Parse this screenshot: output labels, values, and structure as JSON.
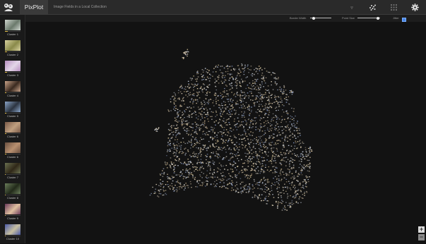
{
  "app": {
    "name": "PixPlot",
    "subtitle": "Image Fields in a Local Collection"
  },
  "toolbar": {
    "icons": [
      "dots-icon",
      "scatter-layout-icon",
      "grid-layout-icon",
      "settings-gear-icon"
    ],
    "border_width_label": "Border Width",
    "border_width_level": 0.15,
    "point_size_label": "Point Size",
    "point_size_level": 0.9,
    "jitter_label": "Jitter",
    "jitter_checked": true
  },
  "sidebar": {
    "clusters": [
      {
        "label": "Cluster 1",
        "progress": 0.2
      },
      {
        "label": "Cluster 2",
        "progress": 0.15
      },
      {
        "label": "Cluster 3",
        "progress": 0.12
      },
      {
        "label": "Cluster 4",
        "progress": 0.1
      },
      {
        "label": "Cluster 5",
        "progress": 0.08
      },
      {
        "label": "Cluster 6",
        "progress": 0.08
      },
      {
        "label": "Cluster 6",
        "progress": 0.07
      },
      {
        "label": "Cluster 7",
        "progress": 0.06
      },
      {
        "label": "Cluster 8",
        "progress": 0.05
      },
      {
        "label": "Cluster 9",
        "progress": 0.05
      },
      {
        "label": "Cluster 10",
        "progress": 0.04
      }
    ]
  },
  "zoom": {
    "in_label": "+",
    "out_label": "−"
  },
  "colors": {
    "background": "#121212",
    "topbar": "#2a2a2a",
    "accent_yellow": "#e8c24a",
    "checkbox_blue": "#4a86e8"
  }
}
